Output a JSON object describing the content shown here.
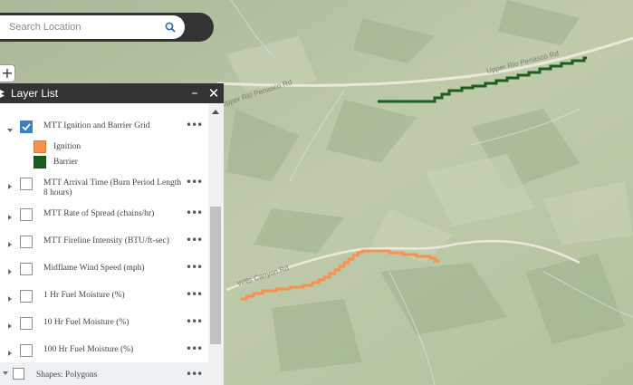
{
  "search": {
    "placeholder": "Search Location"
  },
  "map": {
    "road_labels": [
      "Upper Rio Penasco Rd",
      "Upper Rio Penasco Rd",
      "Wills Canyon Rd"
    ],
    "colors": {
      "terrain": "#b9c6a8",
      "ignition": "#f7924e",
      "barrier": "#1b5e20",
      "road": "#ede8dc"
    },
    "zoom_in_label": "+"
  },
  "layer_list": {
    "title": "Layer List",
    "minimize": "–",
    "close": "✕",
    "layers": [
      {
        "label": "MTT Ignition and Barrier Grid",
        "checked": true,
        "expanded": true
      },
      {
        "label": "MTT Arrival Time (Burn Period Length 8 hours)",
        "checked": false
      },
      {
        "label": "MTT Rate of Spread (chains/hr)",
        "checked": false
      },
      {
        "label": "MTT Fireline Intensity (BTU/ft-sec)",
        "checked": false
      },
      {
        "label": "Midflame Wind Speed (mph)",
        "checked": false
      },
      {
        "label": "1 Hr Fuel Moisture (%)",
        "checked": false
      },
      {
        "label": "10 Hr Fuel Moisture (%)",
        "checked": false
      },
      {
        "label": "100 Hr Fuel Moisture (%)",
        "checked": false
      },
      {
        "label": "Shapes: Polygons",
        "checked": false
      }
    ],
    "legend": [
      {
        "label": "Ignition",
        "color": "#f7924e"
      },
      {
        "label": "Barrier",
        "color": "#1b5e20"
      }
    ],
    "more_icon": "•••"
  }
}
